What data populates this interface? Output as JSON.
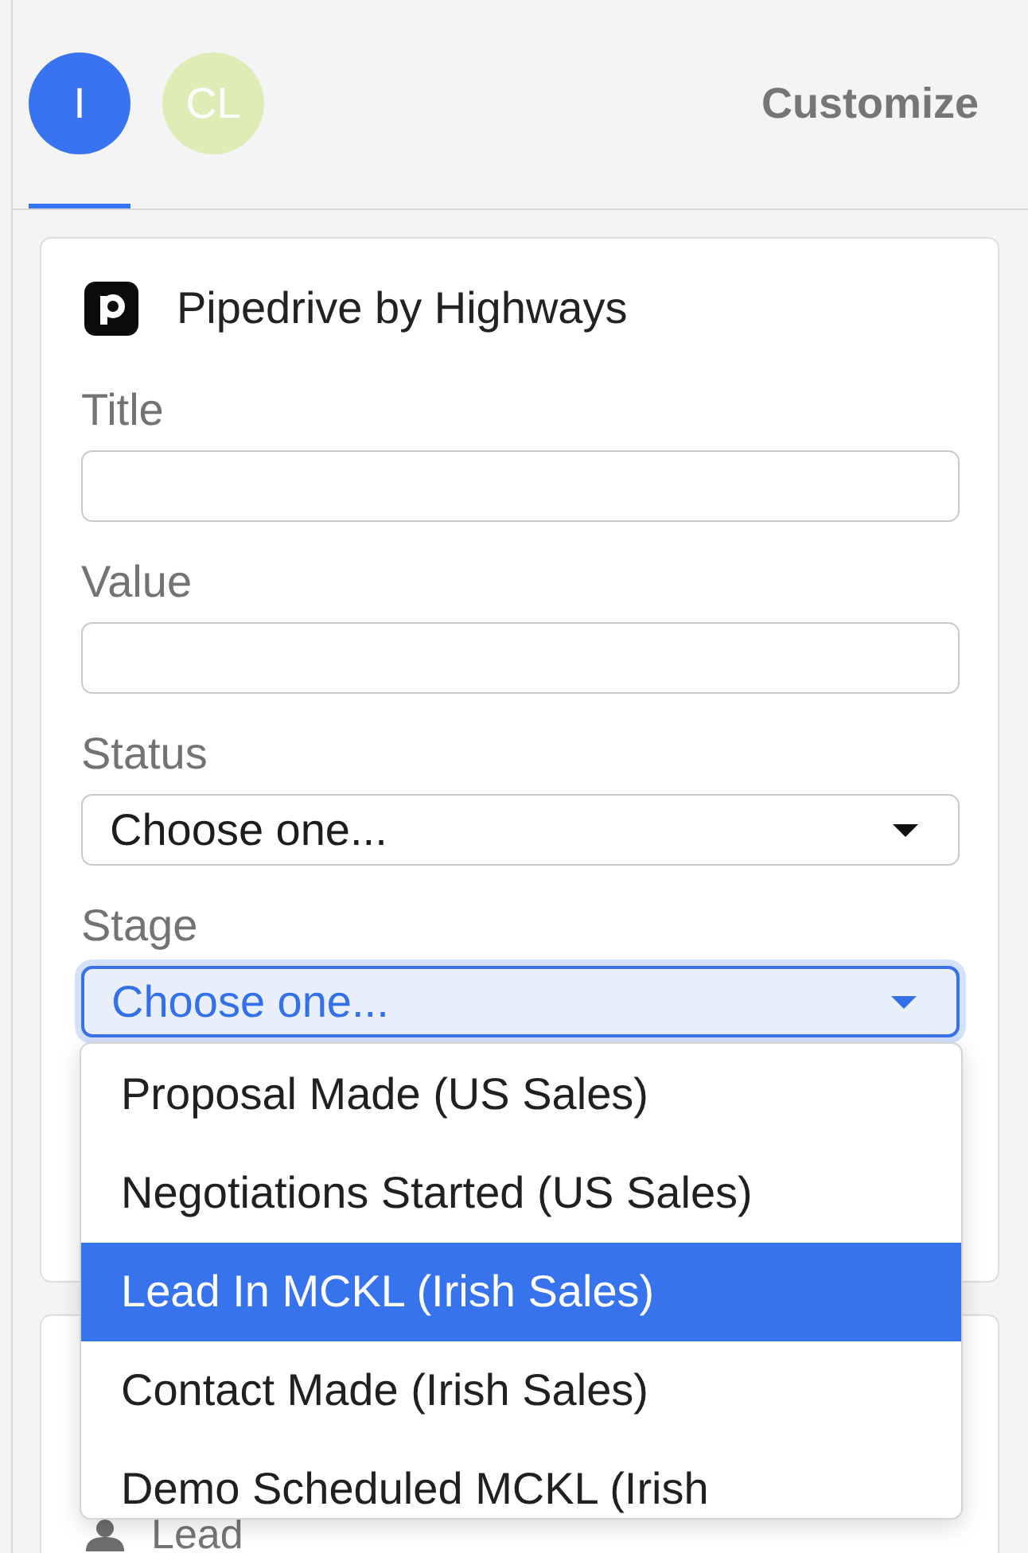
{
  "header": {
    "tabs": [
      {
        "initials": "I",
        "color": "#3873f1",
        "selected": true
      },
      {
        "initials": "CL",
        "color": "#deecb5",
        "selected": false
      }
    ],
    "action": "Customize"
  },
  "form_card": {
    "title": "Pipedrive by Highways",
    "fields": [
      {
        "kind": "text",
        "label": "Title"
      },
      {
        "kind": "text",
        "label": "Value"
      },
      {
        "kind": "select",
        "label": "Status",
        "value": "Choose one...",
        "focused": false
      },
      {
        "kind": "select",
        "label": "Stage",
        "value": "Choose one...",
        "focused": true,
        "expanded": true,
        "options": [
          {
            "label": "Proposal Made (US Sales)",
            "selected": false
          },
          {
            "label": "Negotiations Started (US Sales)",
            "selected": false
          },
          {
            "label": "Lead In MCKL (Irish Sales)",
            "selected": true
          },
          {
            "label": "Contact Made (Irish Sales)",
            "selected": false
          },
          {
            "label": "Demo Scheduled MCKL (Irish",
            "selected": false
          }
        ]
      }
    ]
  },
  "record_card": {
    "label": "Lead"
  }
}
